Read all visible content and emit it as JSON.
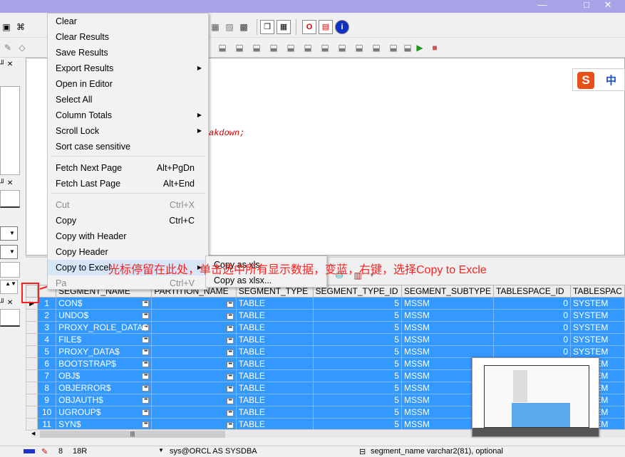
{
  "context_menu": {
    "items": [
      {
        "label": "Clear",
        "shortcut": "",
        "submenu": false,
        "disabled": false
      },
      {
        "label": "Clear Results",
        "shortcut": "",
        "submenu": false,
        "disabled": false
      },
      {
        "label": "Save Results",
        "shortcut": "",
        "submenu": false,
        "disabled": false
      },
      {
        "label": "Export Results",
        "shortcut": "",
        "submenu": true,
        "disabled": false
      },
      {
        "label": "Open in Editor",
        "shortcut": "",
        "submenu": false,
        "disabled": false
      },
      {
        "label": "Select All",
        "shortcut": "",
        "submenu": false,
        "disabled": false
      },
      {
        "label": "Column Totals",
        "shortcut": "",
        "submenu": true,
        "disabled": false
      },
      {
        "label": "Scroll Lock",
        "shortcut": "",
        "submenu": true,
        "disabled": false
      },
      {
        "label": "Sort case sensitive",
        "shortcut": "",
        "submenu": false,
        "disabled": false
      },
      {
        "label": "Fetch Next Page",
        "shortcut": "Alt+PgDn",
        "submenu": false,
        "disabled": false
      },
      {
        "label": "Fetch Last Page",
        "shortcut": "Alt+End",
        "submenu": false,
        "disabled": false
      },
      {
        "label": "Cut",
        "shortcut": "Ctrl+X",
        "submenu": false,
        "disabled": true
      },
      {
        "label": "Copy",
        "shortcut": "Ctrl+C",
        "submenu": false,
        "disabled": false
      },
      {
        "label": "Copy with Header",
        "shortcut": "",
        "submenu": false,
        "disabled": false
      },
      {
        "label": "Copy Header",
        "shortcut": "",
        "submenu": false,
        "disabled": false
      },
      {
        "label": "Copy to Excel",
        "shortcut": "",
        "submenu": true,
        "disabled": false
      },
      {
        "label": "Pa",
        "shortcut": "Ctrl+V",
        "submenu": false,
        "disabled": true
      }
    ]
  },
  "submenu": {
    "items": [
      "Copy as xls",
      "Copy as xlsx..."
    ]
  },
  "annotation": "光标停留在此处，单击选中所有显示数据，变蓝，右键，选择Copy to Excle",
  "editor": {
    "code_tail": "akdown;"
  },
  "ime": {
    "logo": "S",
    "mode": "中"
  },
  "window_controls": {
    "minimize": "—",
    "maximize": "□",
    "close": "✕"
  },
  "grid": {
    "columns": [
      "SEGMENT_NAME",
      "PARTITION_NAME",
      "SEGMENT_TYPE",
      "SEGMENT_TYPE_ID",
      "SEGMENT_SUBTYPE",
      "TABLESPACE_ID",
      "TABLESPAC"
    ],
    "rows": [
      {
        "n": "1",
        "name": "CON$",
        "partition": "",
        "type": "TABLE",
        "type_id": "5",
        "subtype": "MSSM",
        "ts_id": "0",
        "ts": "SYSTEM"
      },
      {
        "n": "2",
        "name": "UNDO$",
        "partition": "",
        "type": "TABLE",
        "type_id": "5",
        "subtype": "MSSM",
        "ts_id": "0",
        "ts": "SYSTEM"
      },
      {
        "n": "3",
        "name": "PROXY_ROLE_DATA$",
        "partition": "",
        "type": "TABLE",
        "type_id": "5",
        "subtype": "MSSM",
        "ts_id": "0",
        "ts": "SYSTEM"
      },
      {
        "n": "4",
        "name": "FILE$",
        "partition": "",
        "type": "TABLE",
        "type_id": "5",
        "subtype": "MSSM",
        "ts_id": "0",
        "ts": "SYSTEM"
      },
      {
        "n": "5",
        "name": "PROXY_DATA$",
        "partition": "",
        "type": "TABLE",
        "type_id": "5",
        "subtype": "MSSM",
        "ts_id": "0",
        "ts": "SYSTEM"
      },
      {
        "n": "6",
        "name": "BOOTSTRAP$",
        "partition": "",
        "type": "TABLE",
        "type_id": "5",
        "subtype": "MSSM",
        "ts_id": "0",
        "ts": "SYSTEM"
      },
      {
        "n": "7",
        "name": "OBJ$",
        "partition": "",
        "type": "TABLE",
        "type_id": "5",
        "subtype": "MSSM",
        "ts_id": "0",
        "ts": "SYSTEM"
      },
      {
        "n": "8",
        "name": "OBJERROR$",
        "partition": "",
        "type": "TABLE",
        "type_id": "5",
        "subtype": "MSSM",
        "ts_id": "0",
        "ts": "SYSTEM"
      },
      {
        "n": "9",
        "name": "OBJAUTH$",
        "partition": "",
        "type": "TABLE",
        "type_id": "5",
        "subtype": "MSSM",
        "ts_id": "0",
        "ts": "SYSTEM"
      },
      {
        "n": "10",
        "name": "UGROUP$",
        "partition": "",
        "type": "TABLE",
        "type_id": "5",
        "subtype": "MSSM",
        "ts_id": "0",
        "ts": "SYSTEM"
      },
      {
        "n": "11",
        "name": "SYN$",
        "partition": "",
        "type": "TABLE",
        "type_id": "5",
        "subtype": "MSSM",
        "ts_id": "0",
        "ts": "SYSTEM"
      }
    ]
  },
  "status_bar": {
    "position": "8",
    "col": "18R",
    "connection": "sys@ORCL AS SYSDBA",
    "hint": "segment_name varchar2(81), optional"
  },
  "colors": {
    "titlebar": "#a9a2e7",
    "selection": "#3399ff",
    "annotation": "#ff2020",
    "code": "#c00000"
  }
}
